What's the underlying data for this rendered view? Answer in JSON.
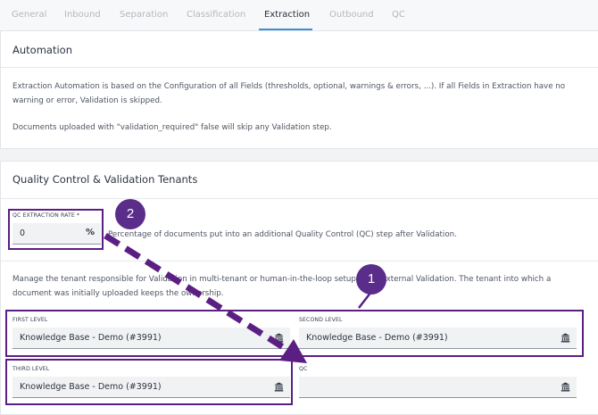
{
  "tabs": [
    "General",
    "Inbound",
    "Separation",
    "Classification",
    "Extraction",
    "Outbound",
    "QC"
  ],
  "active_tab": "Extraction",
  "automation": {
    "title": "Automation",
    "line1": "Extraction Automation is based on the Configuration of all Fields (thresholds, optional, warnings & errors, ...). If all Fields in Extraction have no",
    "line2": "warning or error, Validation is skipped.",
    "line3": "Documents uploaded with \"validation_required\" false will skip any Validation step."
  },
  "qc": {
    "title": "Quality Control & Validation Tenants",
    "rate_label": "QC EXTRACTION RATE *",
    "rate_value": "0",
    "rate_suffix": "%",
    "rate_help": "Percentage of documents put into an additional Quality Control (QC) step after Validation.",
    "tenant_line1": "Manage the tenant responsible for Validation in multi-tenant or human-in-the-loop setups with external Validation. The tenant into which a",
    "tenant_line2": "document was initially uploaded keeps the ownership.",
    "first_level_label": "FIRST LEVEL",
    "first_level_value": "Knowledge Base - Demo (#3991)",
    "second_level_label": "SECOND LEVEL",
    "second_level_value": "Knowledge Base - Demo (#3991)",
    "third_level_label": "THIRD LEVEL",
    "third_level_value": "Knowledge Base - Demo (#3991)",
    "qc_label": "QC",
    "qc_value": ""
  },
  "annotations": {
    "badge1": "1",
    "badge2": "2"
  },
  "colors": {
    "highlight": "#5b1f83",
    "badge": "#5b2d8a",
    "tab_active_underline": "#3a8fd8"
  },
  "icons": {
    "tenant_select": "bank-icon"
  }
}
